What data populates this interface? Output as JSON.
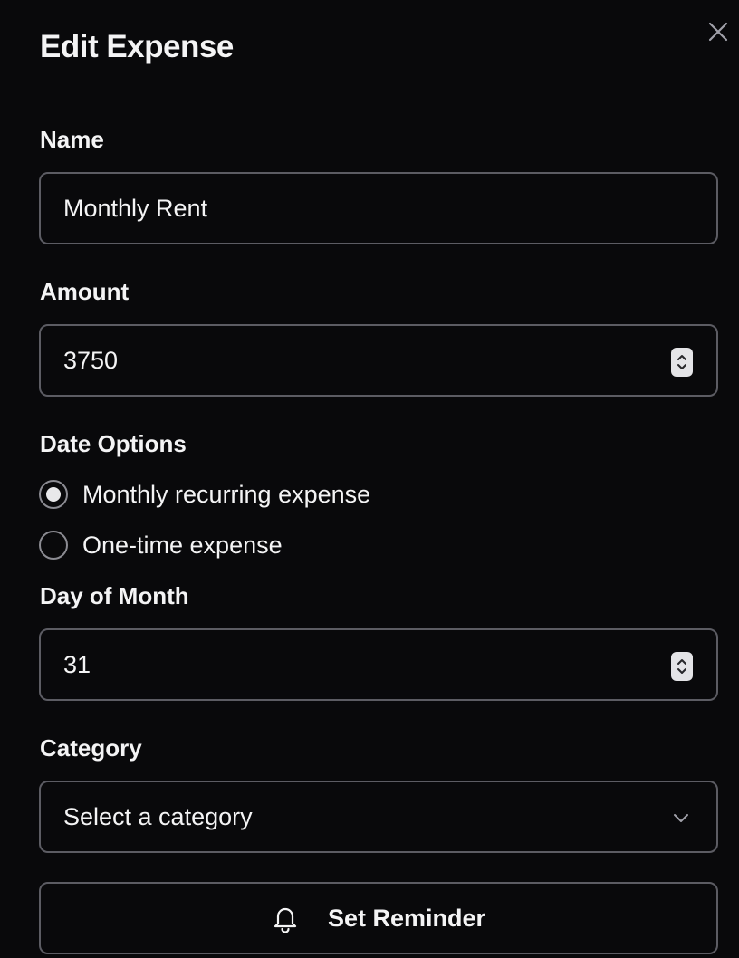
{
  "dialog": {
    "title": "Edit Expense",
    "close_icon": "close-icon"
  },
  "form": {
    "name": {
      "label": "Name",
      "value": "Monthly Rent"
    },
    "amount": {
      "label": "Amount",
      "value": "3750"
    },
    "date_options": {
      "label": "Date Options",
      "options": [
        {
          "label": "Monthly recurring expense",
          "checked": true
        },
        {
          "label": "One-time expense",
          "checked": false
        }
      ]
    },
    "day_of_month": {
      "label": "Day of Month",
      "value": "31"
    },
    "category": {
      "label": "Category",
      "value": "Select a category"
    },
    "reminder_button": {
      "label": "Set Reminder",
      "icon": "bell-icon"
    }
  },
  "colors": {
    "background": "#09090b",
    "border": "#5c5c63",
    "text": "#f4f4f5",
    "radio_checked": "#e8e8ea"
  }
}
